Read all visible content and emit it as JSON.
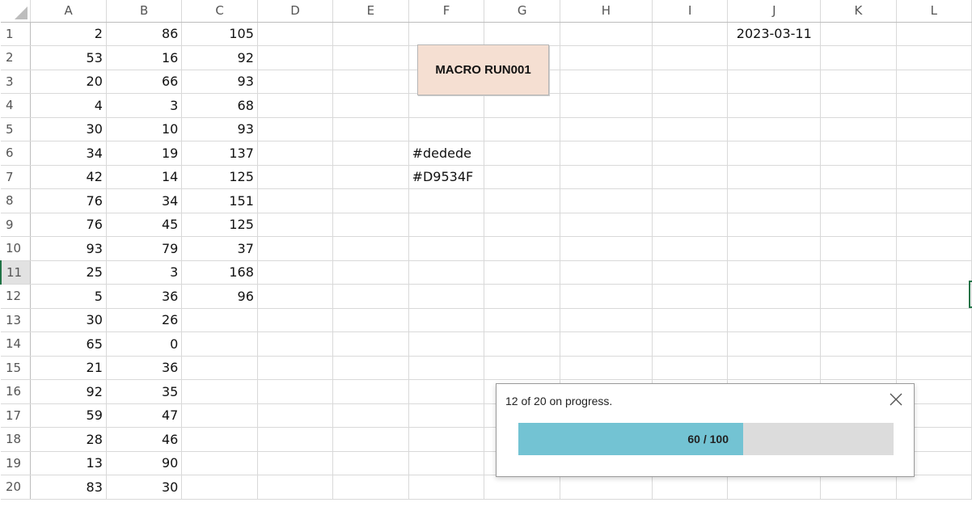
{
  "columns": [
    "A",
    "B",
    "C",
    "D",
    "E",
    "F",
    "G",
    "H",
    "I",
    "J",
    "K",
    "L"
  ],
  "rows": [
    1,
    2,
    3,
    4,
    5,
    6,
    7,
    8,
    9,
    10,
    11,
    12,
    13,
    14,
    15,
    16,
    17,
    18,
    19,
    20
  ],
  "col_a": [
    "2",
    "53",
    "20",
    "4",
    "30",
    "34",
    "42",
    "76",
    "76",
    "93",
    "25",
    "5",
    "30",
    "65",
    "21",
    "92",
    "59",
    "28",
    "13",
    "83"
  ],
  "col_b": [
    "86",
    "16",
    "66",
    "3",
    "10",
    "19",
    "14",
    "34",
    "45",
    "79",
    "3",
    "36",
    "26",
    "0",
    "36",
    "35",
    "47",
    "46",
    "90",
    "30"
  ],
  "col_c": [
    "105",
    "92",
    "93",
    "68",
    "93",
    "137",
    "125",
    "151",
    "125",
    "37",
    "168",
    "96"
  ],
  "cells": {
    "F6": "#dedede",
    "F7": "#D9534F",
    "J1": "2023-03-11"
  },
  "macro_button": {
    "label": "MACRO RUN001",
    "color": "#f5dfd2"
  },
  "progress": {
    "message": "12 of 20 on progress.",
    "label": "60 / 100",
    "value": 60,
    "max": 100,
    "fill_color": "#73c3d3",
    "track_color": "#dcdcdc",
    "close_icon": "close-icon"
  },
  "selected_row": 11,
  "selection_color": "#217346"
}
